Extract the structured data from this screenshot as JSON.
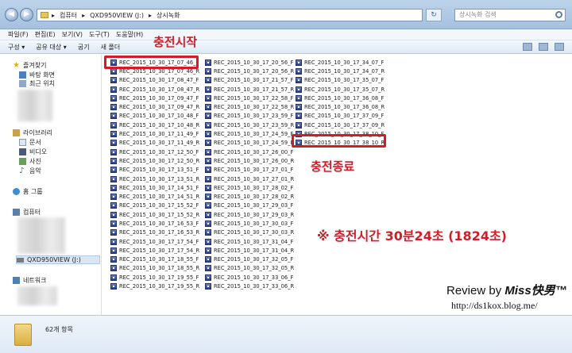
{
  "window": {
    "address_parts": [
      "컴퓨터",
      "QXD950VIEW (J:)",
      "상시녹화"
    ],
    "search_placeholder": "상시녹화 검색"
  },
  "menu": [
    "파일(F)",
    "편집(E)",
    "보기(V)",
    "도구(T)",
    "도움말(H)"
  ],
  "toolbar": [
    "구성 ▾",
    "공유 대상 ▾",
    "굽기",
    "새 폴더"
  ],
  "nav": {
    "favorites": "즐겨찾기",
    "desktop": "바탕 화면",
    "recent": "최근 위치",
    "libraries": "라이브러리",
    "documents": "문서",
    "videos": "비디오",
    "pictures": "사진",
    "music": "음악",
    "homegroup": "홈 그룹",
    "computer": "컴퓨터",
    "drive": "QXD950VIEW (J:)",
    "network": "네트워크"
  },
  "files": {
    "col1": [
      "REC_2015_10_30_17_07_46_F",
      "REC_2015_10_30_17_07_46_R",
      "REC_2015_10_30_17_08_47_F",
      "REC_2015_10_30_17_08_47_R",
      "REC_2015_10_30_17_09_47_F",
      "REC_2015_10_30_17_09_47_R",
      "REC_2015_10_30_17_10_48_F",
      "REC_2015_10_30_17_10_48_R",
      "REC_2015_10_30_17_11_49_F",
      "REC_2015_10_30_17_11_49_R",
      "REC_2015_10_30_17_12_50_F",
      "REC_2015_10_30_17_12_50_R",
      "REC_2015_10_30_17_13_51_F",
      "REC_2015_10_30_17_13_51_R",
      "REC_2015_10_30_17_14_51_F",
      "REC_2015_10_30_17_14_51_R",
      "REC_2015_10_30_17_15_52_F",
      "REC_2015_10_30_17_15_52_R",
      "REC_2015_10_30_17_16_53_F",
      "REC_2015_10_30_17_16_53_R",
      "REC_2015_10_30_17_17_54_F",
      "REC_2015_10_30_17_17_54_R",
      "REC_2015_10_30_17_18_55_F",
      "REC_2015_10_30_17_18_55_R",
      "REC_2015_10_30_17_19_55_F",
      "REC_2015_10_30_17_19_55_R"
    ],
    "col2": [
      "REC_2015_10_30_17_20_56_F",
      "REC_2015_10_30_17_20_56_R",
      "REC_2015_10_30_17_21_57_F",
      "REC_2015_10_30_17_21_57_R",
      "REC_2015_10_30_17_22_58_F",
      "REC_2015_10_30_17_22_58_R",
      "REC_2015_10_30_17_23_59_F",
      "REC_2015_10_30_17_23_59_R",
      "REC_2015_10_30_17_24_59_F",
      "REC_2015_10_30_17_24_59_R",
      "REC_2015_10_30_17_26_00_F",
      "REC_2015_10_30_17_26_00_R",
      "REC_2015_10_30_17_27_01_F",
      "REC_2015_10_30_17_27_01_R",
      "REC_2015_10_30_17_28_02_F",
      "REC_2015_10_30_17_28_02_R",
      "REC_2015_10_30_17_29_03_F",
      "REC_2015_10_30_17_29_03_R",
      "REC_2015_10_30_17_30_03_F",
      "REC_2015_10_30_17_30_03_R",
      "REC_2015_10_30_17_31_04_F",
      "REC_2015_10_30_17_31_04_R",
      "REC_2015_10_30_17_32_05_F",
      "REC_2015_10_30_17_32_05_R",
      "REC_2015_10_30_17_33_06_F",
      "REC_2015_10_30_17_33_06_R"
    ],
    "col3": [
      "REC_2015_10_30_17_34_07_F",
      "REC_2015_10_30_17_34_07_R",
      "REC_2015_10_30_17_35_07_F",
      "REC_2015_10_30_17_35_07_R",
      "REC_2015_10_30_17_36_08_F",
      "REC_2015_10_30_17_36_08_R",
      "REC_2015_10_30_17_37_09_F",
      "REC_2015_10_30_17_37_09_R",
      "REC_2015_10_30_17_38_10_F",
      "REC_2015_10_30_17_38_10_R"
    ]
  },
  "annotations": {
    "charge_start": "충전시작",
    "charge_end": "충전종료",
    "charge_time": "※ 충전시간 30분24초 (1824초)",
    "review": "Review by ",
    "review_brand": "Miss快男™",
    "review_url": "http://ds1kox.blog.me/"
  },
  "status": {
    "item_count": "62개 항목"
  },
  "colors": {
    "annotation_red": "#d41c26",
    "chrome_blue": "#a5c1df"
  }
}
